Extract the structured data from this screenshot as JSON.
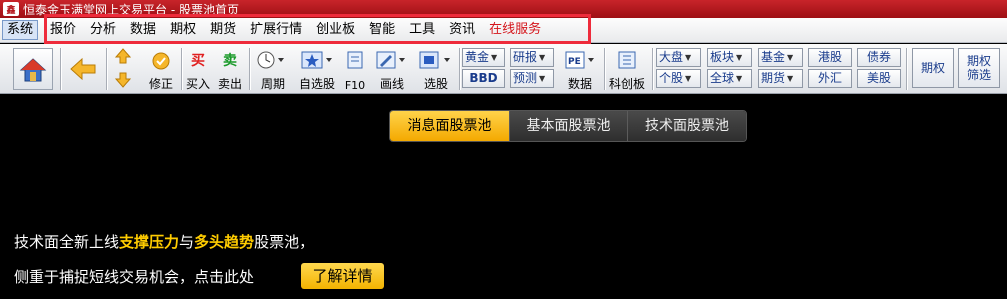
{
  "window": {
    "title": "恒泰金玉满堂网上交易平台 - 股票池首页",
    "logo_text": "鑫"
  },
  "menu": [
    {
      "label": "系统"
    },
    {
      "label": "报价"
    },
    {
      "label": "分析"
    },
    {
      "label": "数据"
    },
    {
      "label": "期权"
    },
    {
      "label": "期货"
    },
    {
      "label": "扩展行情"
    },
    {
      "label": "创业板"
    },
    {
      "label": "智能"
    },
    {
      "label": "工具"
    },
    {
      "label": "资讯"
    },
    {
      "label": "在线服务"
    }
  ],
  "toolbar": {
    "xiuzheng": "修正",
    "buy_icon": "买",
    "buy": "买入",
    "sell_icon": "卖",
    "sell": "卖出",
    "period": "周期",
    "watchlist": "自选股",
    "f10": "F10",
    "drawline": "画线",
    "pick": "选股",
    "huangjin": "黄金",
    "bbd": "BBD",
    "yanbao": "研报",
    "yuce": "预测",
    "pe": "PE",
    "shuju": "数据",
    "kechuang": "科创板",
    "dapan": "大盘",
    "gegu": "个股",
    "bankuai": "板块",
    "quanqiu": "全球",
    "jijin": "基金",
    "qihuo": "期货",
    "ganggu": "港股",
    "waihui": "外汇",
    "zhaiquan": "债券",
    "meigu": "美股",
    "qiquan": "期权",
    "qiquan_shaixuan_1": "期权",
    "qiquan_shaixuan_2": "筛选"
  },
  "tabs": [
    {
      "label": "消息面股票池"
    },
    {
      "label": "基本面股票池"
    },
    {
      "label": "技术面股票池"
    }
  ],
  "promo": {
    "line1_a": "技术面全新上线",
    "line1_hl1": "支撑压力",
    "line1_b": "与",
    "line1_hl2": "多头趋势",
    "line1_c": "股票池，",
    "line2": "侧重于捕捉短线交易机会，点击此处",
    "button": "了解详情"
  },
  "colors": {
    "accent": "#f4b400",
    "menu_highlight_box": "#ee2b3b",
    "titlebar": "#b3151b",
    "service_menu": "#d4151b"
  }
}
